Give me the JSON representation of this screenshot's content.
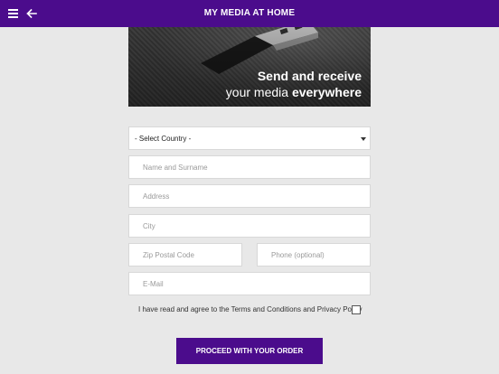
{
  "header": {
    "title": "MY MEDIA AT HOME",
    "menu_icon": "hamburger-menu-icon",
    "back_icon": "arrow-left-icon"
  },
  "hero": {
    "line1": "Send and receive",
    "line2_prefix": "your media ",
    "line2_bold": "everywhere",
    "image": "usb-flash-drive-icon"
  },
  "form": {
    "country": {
      "selected": "- Select Country -"
    },
    "name": {
      "placeholder": "Name and Surname"
    },
    "address": {
      "placeholder": "Address"
    },
    "city": {
      "placeholder": "City"
    },
    "zip": {
      "placeholder": "Zip Postal Code"
    },
    "phone": {
      "placeholder": "Phone (optional)"
    },
    "email": {
      "placeholder": "E-Mail"
    },
    "terms_label": "I have read and agree to the Terms and Conditions and Privacy Policy",
    "terms_checked": false,
    "submit_label": "PROCEED WITH YOUR ORDER"
  },
  "colors": {
    "brand": "#4b0c8c",
    "background": "#e8e8e8",
    "field": "#ffffff"
  }
}
